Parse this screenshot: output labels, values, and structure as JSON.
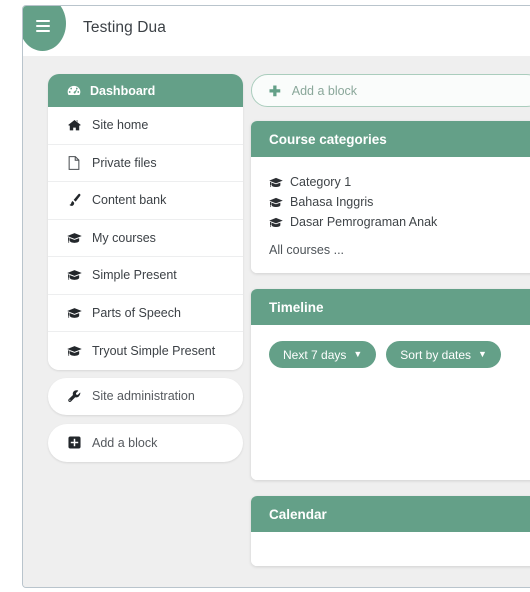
{
  "header": {
    "title": "Testing Dua",
    "menu_button_icon": "hamburger-menu-icon",
    "menu_button_label": "Toggle navigation"
  },
  "sidebar": {
    "dashboard": {
      "label": "Dashboard",
      "icon": "tachometer-icon",
      "active": true
    },
    "items": [
      {
        "label": "Site home",
        "icon": "home-icon"
      },
      {
        "label": "Private files",
        "icon": "file-icon"
      },
      {
        "label": "Content bank",
        "icon": "paint-brush-icon"
      },
      {
        "label": "My courses",
        "icon": "graduation-cap-icon"
      },
      {
        "label": "Simple Present",
        "icon": "graduation-cap-icon"
      },
      {
        "label": "Parts of Speech",
        "icon": "graduation-cap-icon"
      },
      {
        "label": "Tryout Simple Present",
        "icon": "graduation-cap-icon"
      }
    ],
    "standalone": [
      {
        "label": "Site administration",
        "icon": "wrench-icon"
      },
      {
        "label": "Add a block",
        "icon": "plus-square-icon"
      }
    ]
  },
  "main": {
    "add_block": {
      "label": "Add a block",
      "icon": "plus-icon"
    },
    "blocks": [
      {
        "id": "course-categories",
        "title": "Course categories",
        "categories": [
          {
            "label": "Category 1",
            "icon": "graduation-cap-icon"
          },
          {
            "label": "Bahasa Inggris",
            "icon": "graduation-cap-icon"
          },
          {
            "label": "Dasar Pemrograman Anak",
            "icon": "graduation-cap-icon"
          }
        ],
        "all_courses_label": "All courses ..."
      },
      {
        "id": "timeline",
        "title": "Timeline",
        "filters": [
          {
            "label": "Next 7 days",
            "icon": "chevron-down-icon"
          },
          {
            "label": "Sort by dates",
            "icon": "chevron-down-icon"
          }
        ]
      },
      {
        "id": "calendar",
        "title": "Calendar"
      }
    ]
  },
  "colors": {
    "brand_green": "#64a088",
    "page_background": "#efefef",
    "card_background": "#ffffff",
    "text_dark": "#3c4146",
    "muted_green_text": "#8aa79a"
  }
}
